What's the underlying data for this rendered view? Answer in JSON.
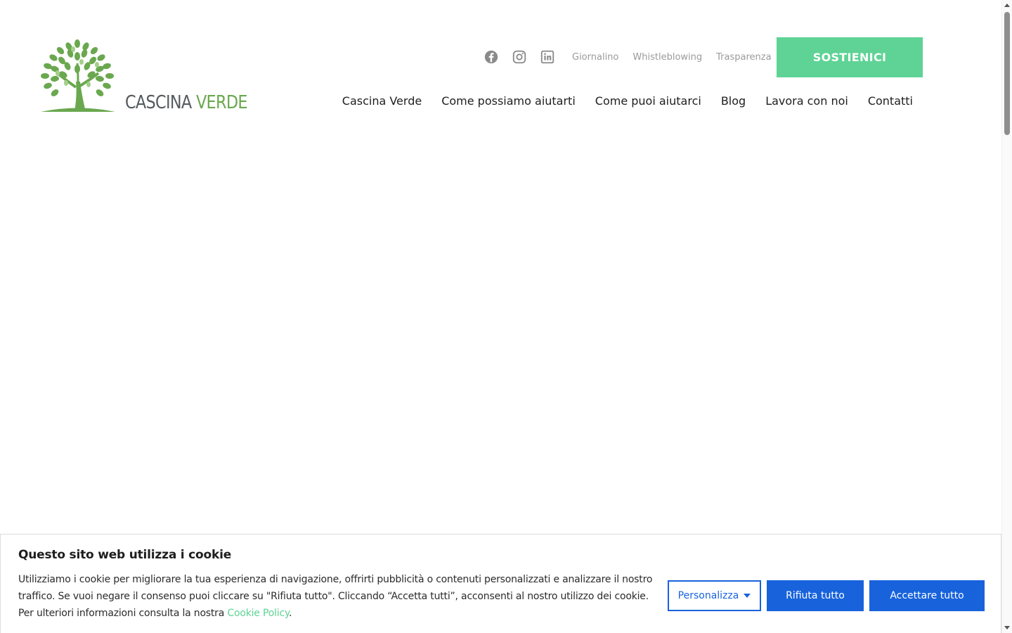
{
  "header": {
    "logo": {
      "word1": "CASCINA",
      "word2": "VERDE"
    },
    "social": [
      {
        "name": "facebook-icon"
      },
      {
        "name": "instagram-icon"
      },
      {
        "name": "linkedin-icon"
      }
    ],
    "utility_links": [
      "Giornalino",
      "Whistleblowing",
      "Trasparenza"
    ],
    "cta_label": "SOSTIENICI",
    "nav": [
      "Cascina Verde",
      "Come possiamo aiutarti",
      "Come puoi aiutarci",
      "Blog",
      "Lavora con noi",
      "Contatti"
    ]
  },
  "cookie_banner": {
    "title": "Questo sito web utilizza i cookie",
    "text": "Utilizziamo i cookie per migliorare la tua esperienza di navigazione, offrirti pubblicità o contenuti personalizzati e analizzare il nostro traffico. Se vuoi negare il consenso puoi cliccare su \"Rifiuta tutto\". Cliccando “Accetta tutti”, acconsenti al nostro utilizzo dei cookie. Per ulteriori informazioni consulta la nostra",
    "link_label": "Cookie Policy",
    "text_end": ".",
    "customize_label": "Personalizza",
    "reject_label": "Rifiuta tutto",
    "accept_label": "Accettare tutto"
  },
  "colors": {
    "brand_green": "#6aa84f",
    "cta_green": "#5ed395",
    "button_blue": "#1863dc",
    "icon_gray": "#8a8a8a"
  }
}
